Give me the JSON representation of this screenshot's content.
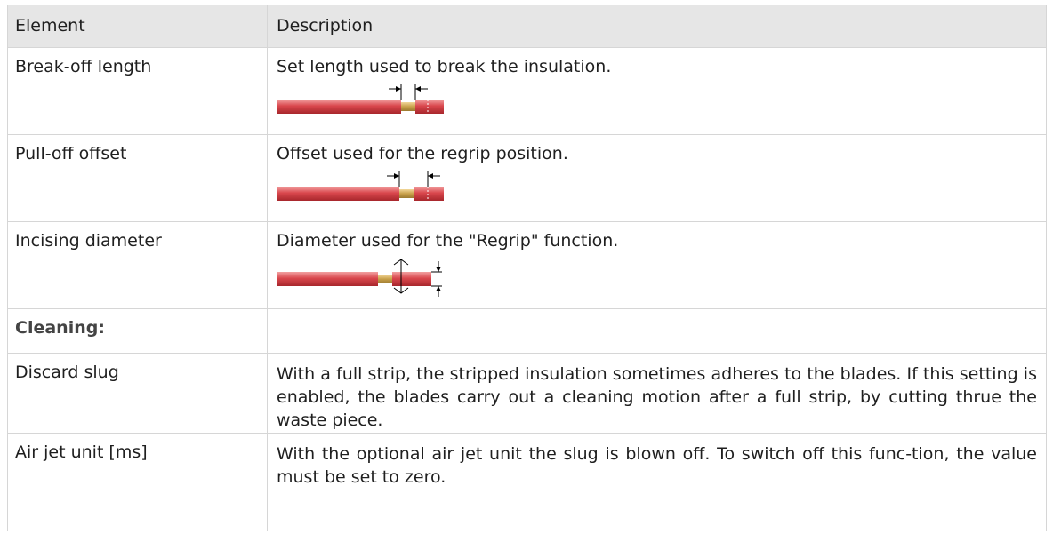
{
  "table": {
    "headers": {
      "element": "Element",
      "description": "Description"
    },
    "rows": [
      {
        "element": "Break-off length",
        "description": "Set length used to break the insulation."
      },
      {
        "element": "Pull-off offset",
        "description": "Offset used for the regrip position."
      },
      {
        "element": "Incising diameter",
        "description": "Diameter used for the \"Regrip\" function."
      },
      {
        "element": "Cleaning:",
        "description": ""
      },
      {
        "element": "Discard slug",
        "description": "With a full strip, the stripped insulation sometimes adheres to the blades. If this setting is enabled, the blades carry out a cleaning motion after a full strip, by cutting thrue the waste piece."
      },
      {
        "element": "Air jet unit [ms]",
        "description": "With the optional air jet unit the slug is blown off. To switch off this func-tion, the value must be set to zero."
      }
    ]
  },
  "colors": {
    "header_bg": "#e6e6e6",
    "cable_red": "#d9474d",
    "cable_core": "#c8a04a",
    "border": "#d6d6d6"
  }
}
